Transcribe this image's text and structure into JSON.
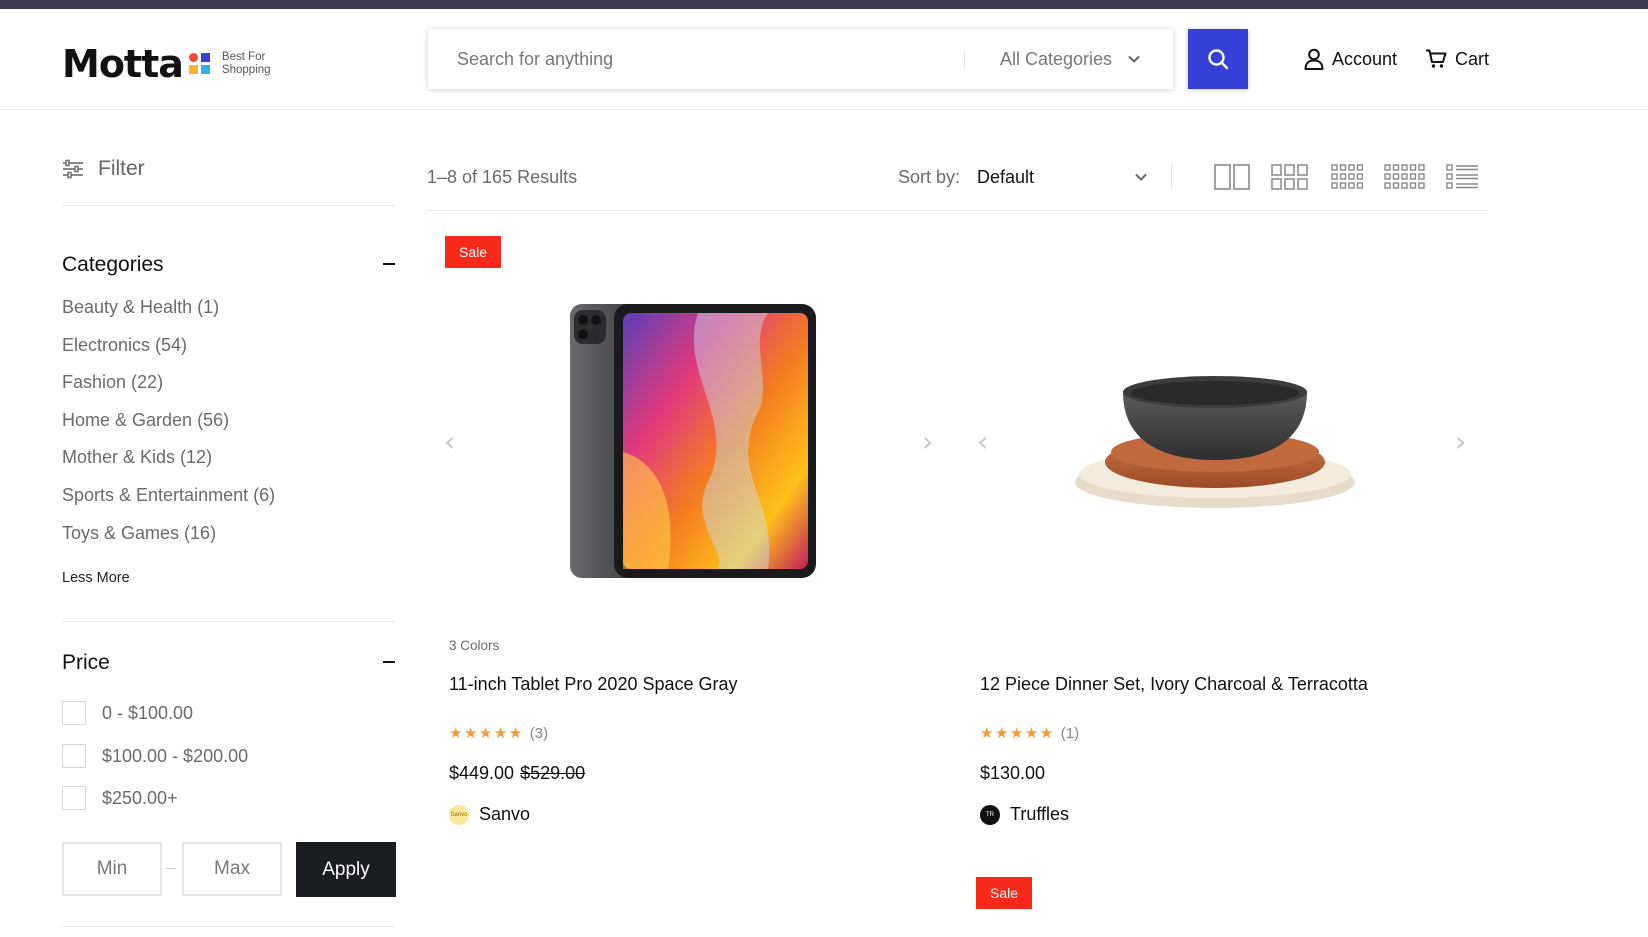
{
  "header": {
    "logo_text": "Motta",
    "logo_tagline_1": "Best For",
    "logo_tagline_2": "Shopping",
    "search_placeholder": "Search for anything",
    "search_category": "All Categories",
    "account_label": "Account",
    "cart_label": "Cart"
  },
  "sidebar": {
    "filter_label": "Filter",
    "categories_title": "Categories",
    "categories": [
      {
        "name": "Beauty & Health",
        "count": "(1)"
      },
      {
        "name": "Electronics",
        "count": "(54)"
      },
      {
        "name": "Fashion",
        "count": "(22)"
      },
      {
        "name": "Home & Garden",
        "count": "(56)"
      },
      {
        "name": "Mother & Kids",
        "count": "(12)"
      },
      {
        "name": "Sports & Entertainment",
        "count": "(6)"
      },
      {
        "name": "Toys & Games",
        "count": "(16)"
      }
    ],
    "less_more_label": "Less More",
    "price_title": "Price",
    "price_options": [
      "0 - $100.00",
      "$100.00 - $200.00",
      "$250.00+"
    ],
    "min_placeholder": "Min",
    "max_placeholder": "Max",
    "apply_label": "Apply"
  },
  "toolbar": {
    "results_text": "1–8 of 165 Results",
    "sort_label": "Sort by:",
    "sort_value": "Default",
    "view_modes": [
      "grid-2-icon",
      "grid-3-icon",
      "grid-4-icon",
      "grid-5-icon",
      "list-view-icon"
    ]
  },
  "products": [
    {
      "badge": "Sale",
      "colors": "3 Colors",
      "title": "11-inch Tablet Pro 2020 Space Gray",
      "stars": "★★★★★",
      "rating_count": "(3)",
      "price": "$449.00",
      "old_price": "$529.00",
      "brand": "Sanvo"
    },
    {
      "badge": "",
      "colors": "",
      "title": "12 Piece Dinner Set, Ivory Charcoal & Terracotta",
      "stars": "★★★★★",
      "rating_count": "(1)",
      "price": "$130.00",
      "old_price": "",
      "brand": "Truffles"
    }
  ],
  "next_row_badge": "Sale",
  "colors": {
    "accent": "#3540d6",
    "sale": "#f6291b",
    "star": "#f59a3c",
    "topbar": "#3d3b51",
    "apply": "#1a1d21"
  }
}
